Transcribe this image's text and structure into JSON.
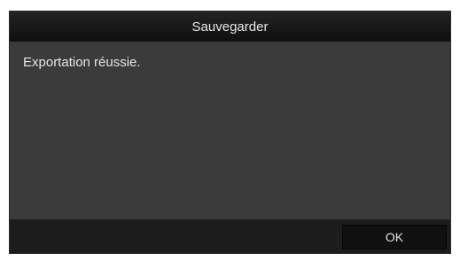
{
  "dialog": {
    "title": "Sauvegarder",
    "message": "Exportation réussie.",
    "ok_label": "OK"
  },
  "colors": {
    "titlebar": "#151515",
    "body": "#3b3b3b",
    "footer": "#1c1c1c",
    "button": "#101010",
    "text": "#e6e6e6"
  }
}
